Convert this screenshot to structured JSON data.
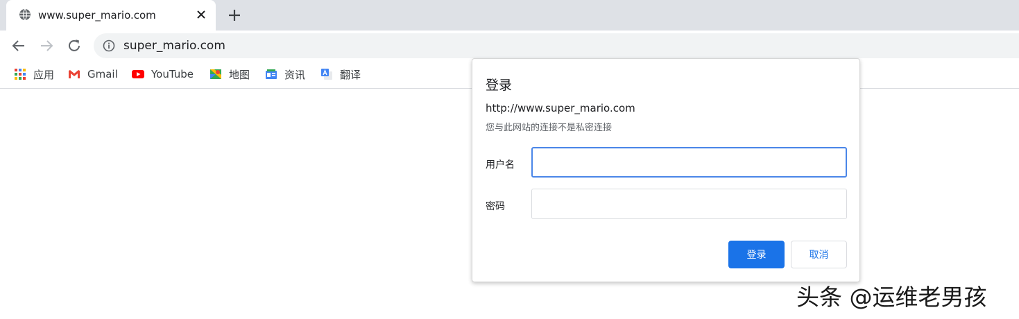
{
  "tab": {
    "title": "www.super_mario.com",
    "favicon": "globe-icon",
    "close_icon": "close-icon"
  },
  "toolbar": {
    "back_icon": "arrow-back-icon",
    "forward_icon": "arrow-forward-icon",
    "reload_icon": "reload-icon",
    "url": "super_mario.com",
    "security_icon": "info-icon"
  },
  "bookmarks": [
    {
      "label": "应用",
      "icon": "apps-grid-icon"
    },
    {
      "label": "Gmail",
      "icon": "gmail-icon"
    },
    {
      "label": "YouTube",
      "icon": "youtube-icon"
    },
    {
      "label": "地图",
      "icon": "maps-icon"
    },
    {
      "label": "资讯",
      "icon": "news-icon"
    },
    {
      "label": "翻译",
      "icon": "translate-icon"
    }
  ],
  "dialog": {
    "title": "登录",
    "origin": "http://www.super_mario.com",
    "warning": "您与此网站的连接不是私密连接",
    "username_label": "用户名",
    "username_value": "",
    "password_label": "密码",
    "password_value": "",
    "login_button": "登录",
    "cancel_button": "取消"
  },
  "watermark": "头条 @运维老男孩",
  "colors": {
    "tabstrip_bg": "#dee1e6",
    "omnibox_bg": "#f1f3f4",
    "accent": "#1a73e8",
    "focus_ring": "#4a86e8"
  }
}
